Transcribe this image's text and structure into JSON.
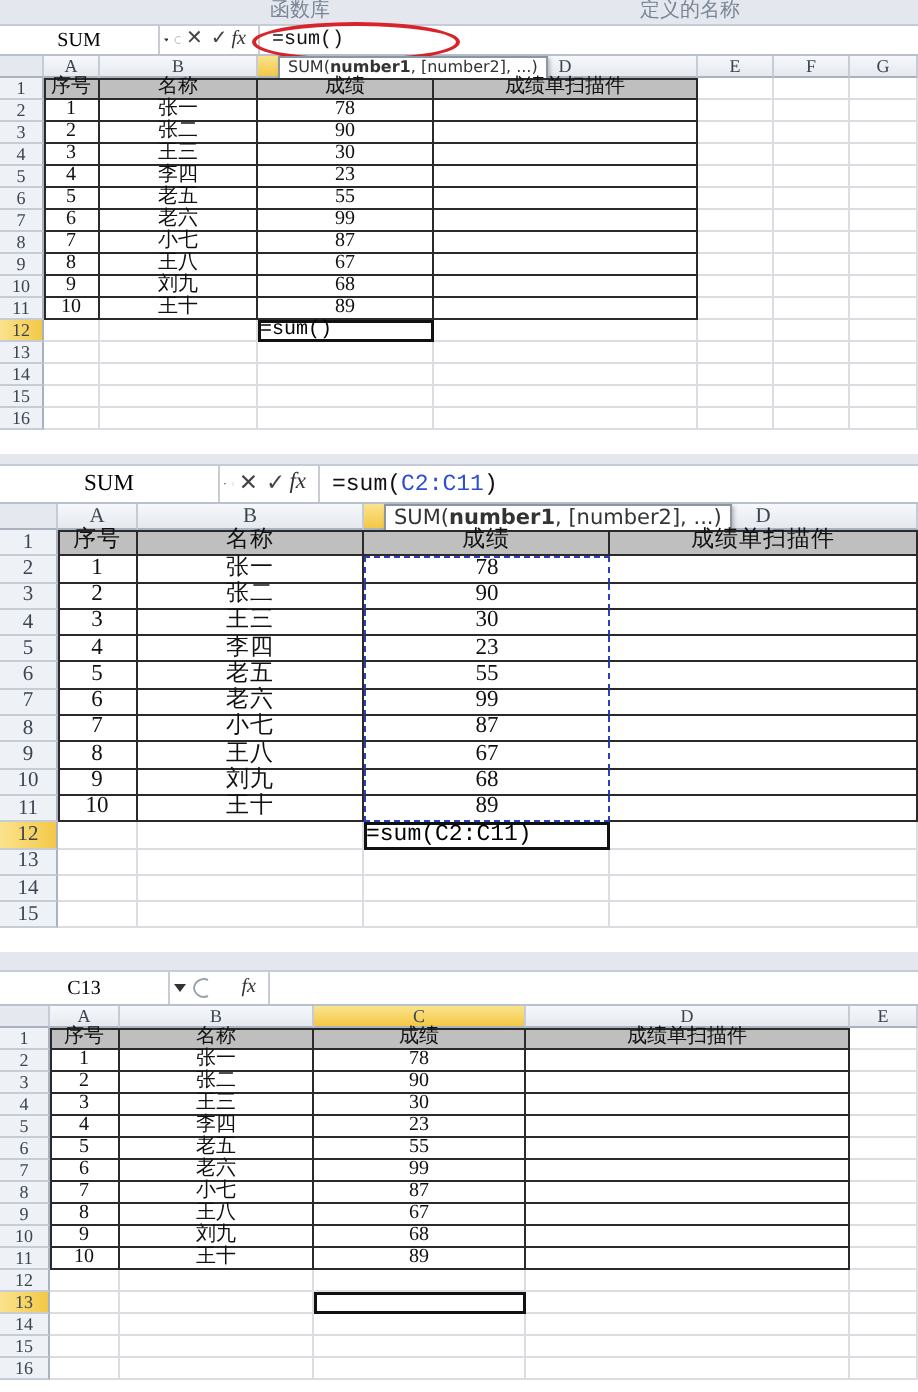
{
  "panels": [
    {
      "ribbon_groups": [
        "函数库",
        "定义的名称"
      ],
      "name_box": "SUM",
      "edit_buttons": [
        "✕",
        "✓"
      ],
      "function_label": "fx",
      "formula": [
        {
          "text": "=sum()",
          "kind": "plain"
        }
      ],
      "annotated": true,
      "tooltip": "SUM(**number1**, [number2], ...)",
      "columns": [
        {
          "label": "A",
          "selected": false
        },
        {
          "label": "B",
          "selected": false
        },
        {
          "selected": true
        },
        {
          "label": "D",
          "selected": false
        },
        {
          "label": "E",
          "selected": false
        },
        {
          "label": "F",
          "selected": false
        },
        {
          "label": "G",
          "selected": false
        }
      ],
      "rows": [
        {
          "label": "1",
          "kind": "header",
          "selected": false,
          "cells": [
            "序号",
            "名称",
            "成绩",
            "成绩单扫描件"
          ]
        },
        {
          "label": "2",
          "kind": "data",
          "selected": false,
          "cells": [
            "1",
            "张一",
            "78"
          ]
        },
        {
          "label": "3",
          "kind": "data",
          "selected": false,
          "cells": [
            "2",
            "张二",
            "90"
          ]
        },
        {
          "label": "4",
          "kind": "data",
          "selected": false,
          "cells": [
            "3",
            "王三",
            "30"
          ]
        },
        {
          "label": "5",
          "kind": "data",
          "selected": false,
          "cells": [
            "4",
            "李四",
            "23"
          ]
        },
        {
          "label": "6",
          "kind": "data",
          "selected": false,
          "cells": [
            "5",
            "老五",
            "55"
          ]
        },
        {
          "label": "7",
          "kind": "data",
          "selected": false,
          "cells": [
            "6",
            "老六",
            "99"
          ]
        },
        {
          "label": "8",
          "kind": "data",
          "selected": false,
          "cells": [
            "7",
            "小七",
            "87"
          ]
        },
        {
          "label": "9",
          "kind": "data",
          "selected": false,
          "cells": [
            "8",
            "王八",
            "67"
          ]
        },
        {
          "label": "10",
          "kind": "data",
          "selected": false,
          "cells": [
            "9",
            "刘九",
            "68"
          ]
        },
        {
          "label": "11",
          "kind": "data",
          "selected": false,
          "cells": [
            "10",
            "王十",
            "89"
          ]
        },
        {
          "label": "12",
          "kind": "empty",
          "selected": true,
          "entry": "=sum()"
        },
        {
          "label": "13",
          "kind": "empty",
          "selected": false
        },
        {
          "label": "14",
          "kind": "empty",
          "selected": false
        },
        {
          "label": "15",
          "kind": "empty",
          "selected": false
        },
        {
          "label": "16",
          "kind": "empty",
          "selected": false
        }
      ]
    },
    {
      "name_box": "SUM",
      "edit_buttons": [
        "✕",
        "✓"
      ],
      "function_label": "fx",
      "formula": [
        {
          "text": "=sum(",
          "kind": "plain"
        },
        {
          "text": "C2:C11",
          "kind": "reference"
        },
        {
          "text": ")",
          "kind": "plain"
        }
      ],
      "tooltip": "SUM(**number1**, [number2], ...)",
      "columns": [
        {
          "label": "A",
          "selected": false
        },
        {
          "label": "B",
          "selected": false
        },
        {
          "selected": true
        },
        {
          "label": "D",
          "selected": false
        }
      ],
      "rows": [
        {
          "label": "1",
          "kind": "header",
          "selected": false,
          "referenced": false,
          "cells": [
            "序号",
            "名称",
            "成绩",
            "成绩单扫描件"
          ]
        },
        {
          "label": "2",
          "kind": "data",
          "selected": false,
          "referenced": true,
          "cells": [
            "1",
            "张一",
            "78"
          ]
        },
        {
          "label": "3",
          "kind": "data",
          "selected": false,
          "referenced": true,
          "cells": [
            "2",
            "张二",
            "90"
          ]
        },
        {
          "label": "4",
          "kind": "data",
          "selected": false,
          "referenced": true,
          "cells": [
            "3",
            "王三",
            "30"
          ]
        },
        {
          "label": "5",
          "kind": "data",
          "selected": false,
          "referenced": true,
          "cells": [
            "4",
            "李四",
            "23"
          ]
        },
        {
          "label": "6",
          "kind": "data",
          "selected": false,
          "referenced": true,
          "cells": [
            "5",
            "老五",
            "55"
          ]
        },
        {
          "label": "7",
          "kind": "data",
          "selected": false,
          "referenced": true,
          "cells": [
            "6",
            "老六",
            "99"
          ]
        },
        {
          "label": "8",
          "kind": "data",
          "selected": false,
          "referenced": true,
          "cells": [
            "7",
            "小七",
            "87"
          ]
        },
        {
          "label": "9",
          "kind": "data",
          "selected": false,
          "referenced": true,
          "cells": [
            "8",
            "王八",
            "67"
          ]
        },
        {
          "label": "10",
          "kind": "data",
          "selected": false,
          "referenced": true,
          "cells": [
            "9",
            "刘九",
            "68"
          ]
        },
        {
          "label": "11",
          "kind": "data",
          "selected": false,
          "referenced": true,
          "cells": [
            "10",
            "王十",
            "89"
          ]
        },
        {
          "label": "12",
          "kind": "empty",
          "selected": true,
          "referenced": false,
          "entry": "=sum(C2:C11)"
        },
        {
          "label": "13",
          "kind": "empty",
          "selected": false,
          "referenced": false
        },
        {
          "label": "14",
          "kind": "empty",
          "selected": false,
          "referenced": false
        },
        {
          "label": "15",
          "kind": "empty",
          "selected": false,
          "referenced": false
        }
      ]
    },
    {
      "name_box": "C13",
      "function_label": "fx",
      "columns": [
        {
          "label": "A",
          "selected": false
        },
        {
          "label": "B",
          "selected": false
        },
        {
          "label": "C",
          "selected": true
        },
        {
          "label": "D",
          "selected": false
        },
        {
          "label": "E",
          "selected": false
        }
      ],
      "rows": [
        {
          "label": "1",
          "kind": "header",
          "selected": false,
          "cells": [
            "序号",
            "名称",
            "成绩",
            "成绩单扫描件"
          ]
        },
        {
          "label": "2",
          "kind": "data",
          "selected": false,
          "cells": [
            "1",
            "张一",
            "78"
          ]
        },
        {
          "label": "3",
          "kind": "data",
          "selected": false,
          "cells": [
            "2",
            "张二",
            "90"
          ]
        },
        {
          "label": "4",
          "kind": "data",
          "selected": false,
          "cells": [
            "3",
            "王三",
            "30"
          ]
        },
        {
          "label": "5",
          "kind": "data",
          "selected": false,
          "cells": [
            "4",
            "李四",
            "23"
          ]
        },
        {
          "label": "6",
          "kind": "data",
          "selected": false,
          "cells": [
            "5",
            "老五",
            "55"
          ]
        },
        {
          "label": "7",
          "kind": "data",
          "selected": false,
          "cells": [
            "6",
            "老六",
            "99"
          ]
        },
        {
          "label": "8",
          "kind": "data",
          "selected": false,
          "cells": [
            "7",
            "小七",
            "87"
          ]
        },
        {
          "label": "9",
          "kind": "data",
          "selected": false,
          "cells": [
            "8",
            "王八",
            "67"
          ]
        },
        {
          "label": "10",
          "kind": "data",
          "selected": false,
          "cells": [
            "9",
            "刘九",
            "68"
          ]
        },
        {
          "label": "11",
          "kind": "data",
          "selected": false,
          "cells": [
            "10",
            "王十",
            "89"
          ]
        },
        {
          "label": "12",
          "kind": "empty",
          "selected": false
        },
        {
          "label": "13",
          "kind": "empty",
          "selected": true
        },
        {
          "label": "14",
          "kind": "empty",
          "selected": false
        },
        {
          "label": "15",
          "kind": "empty",
          "selected": false
        },
        {
          "label": "16",
          "kind": "empty",
          "selected": false
        }
      ]
    }
  ]
}
